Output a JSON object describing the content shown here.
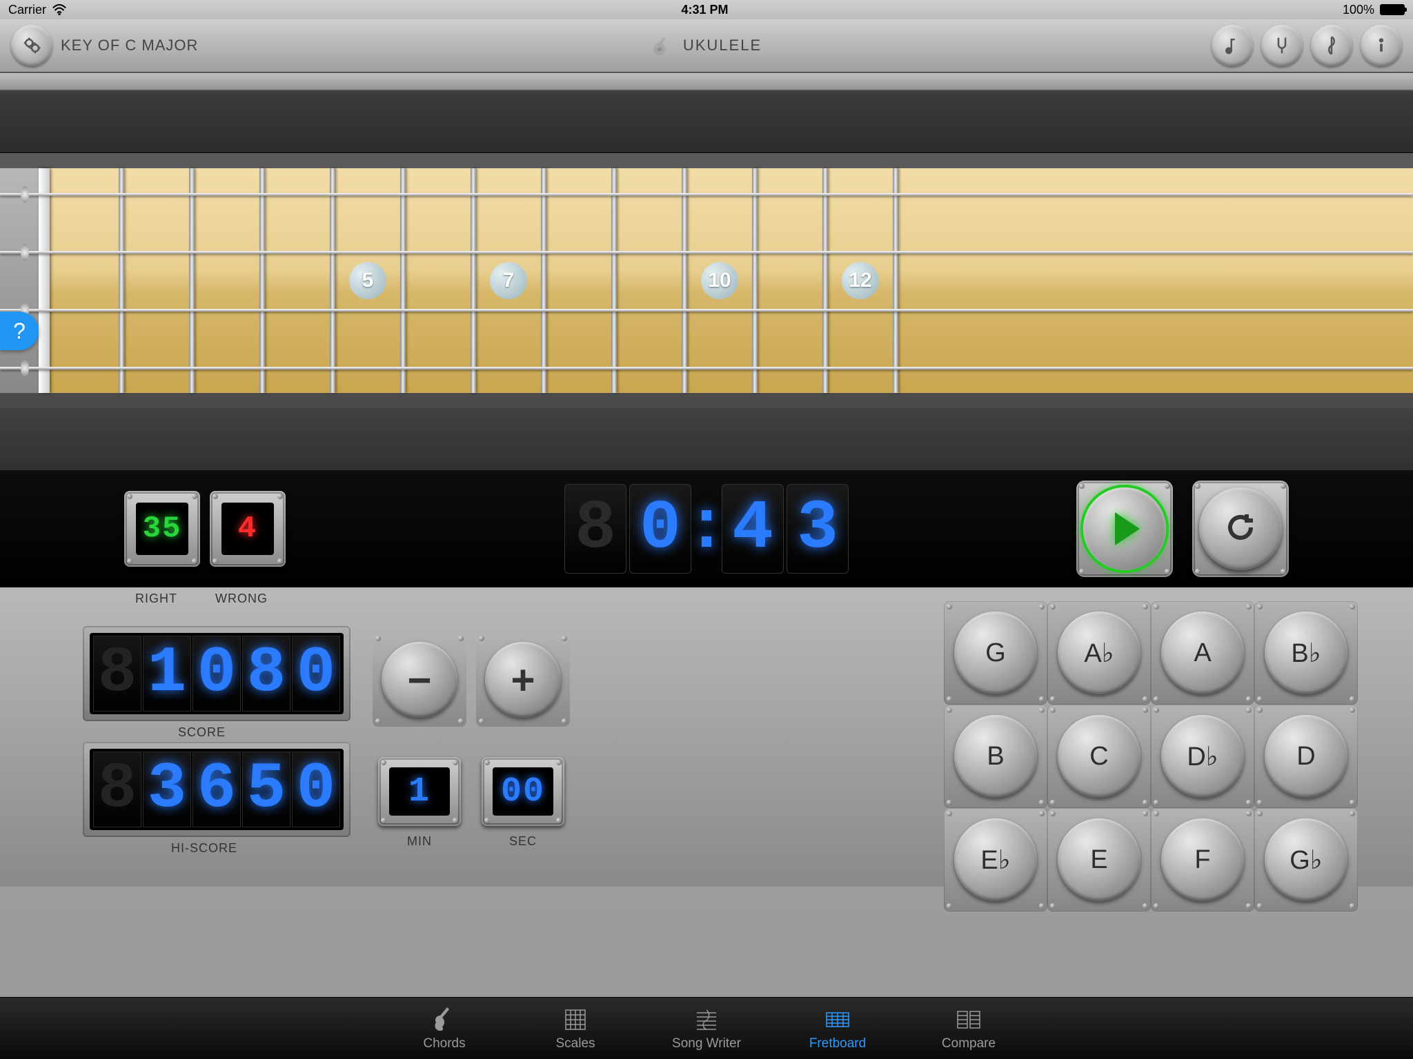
{
  "status": {
    "carrier": "Carrier",
    "time": "4:31 PM",
    "battery": "100%"
  },
  "toolbar": {
    "key_label": "KEY OF C MAJOR",
    "instrument": "UKULELE",
    "icons": [
      "notes-icon",
      "tuning-fork-icon",
      "treble-clef-icon",
      "info-icon"
    ]
  },
  "fretboard": {
    "markers": [
      {
        "fret": 5,
        "label": "5"
      },
      {
        "fret": 7,
        "label": "7"
      },
      {
        "fret": 10,
        "label": "10"
      },
      {
        "fret": 12,
        "label": "12"
      }
    ],
    "strings": 4,
    "frets": 12,
    "help": "?"
  },
  "game": {
    "right_label": "RIGHT",
    "wrong_label": "WRONG",
    "right": "35",
    "wrong": "4",
    "timer": "0:43",
    "score_label": "SCORE",
    "hiscore_label": "HI-SCORE",
    "score": "1080",
    "hiscore": "3650",
    "min_label": "MIN",
    "sec_label": "SEC",
    "min": "1",
    "sec": "00"
  },
  "controls": {
    "minus": "−",
    "plus": "+"
  },
  "notes": [
    "G",
    "A♭",
    "A",
    "B♭",
    "B",
    "C",
    "D♭",
    "D",
    "E♭",
    "E",
    "F",
    "G♭"
  ],
  "tabs": [
    {
      "id": "chords",
      "label": "Chords"
    },
    {
      "id": "scales",
      "label": "Scales"
    },
    {
      "id": "songwriter",
      "label": "Song Writer"
    },
    {
      "id": "fretboard",
      "label": "Fretboard",
      "active": true
    },
    {
      "id": "compare",
      "label": "Compare"
    }
  ]
}
